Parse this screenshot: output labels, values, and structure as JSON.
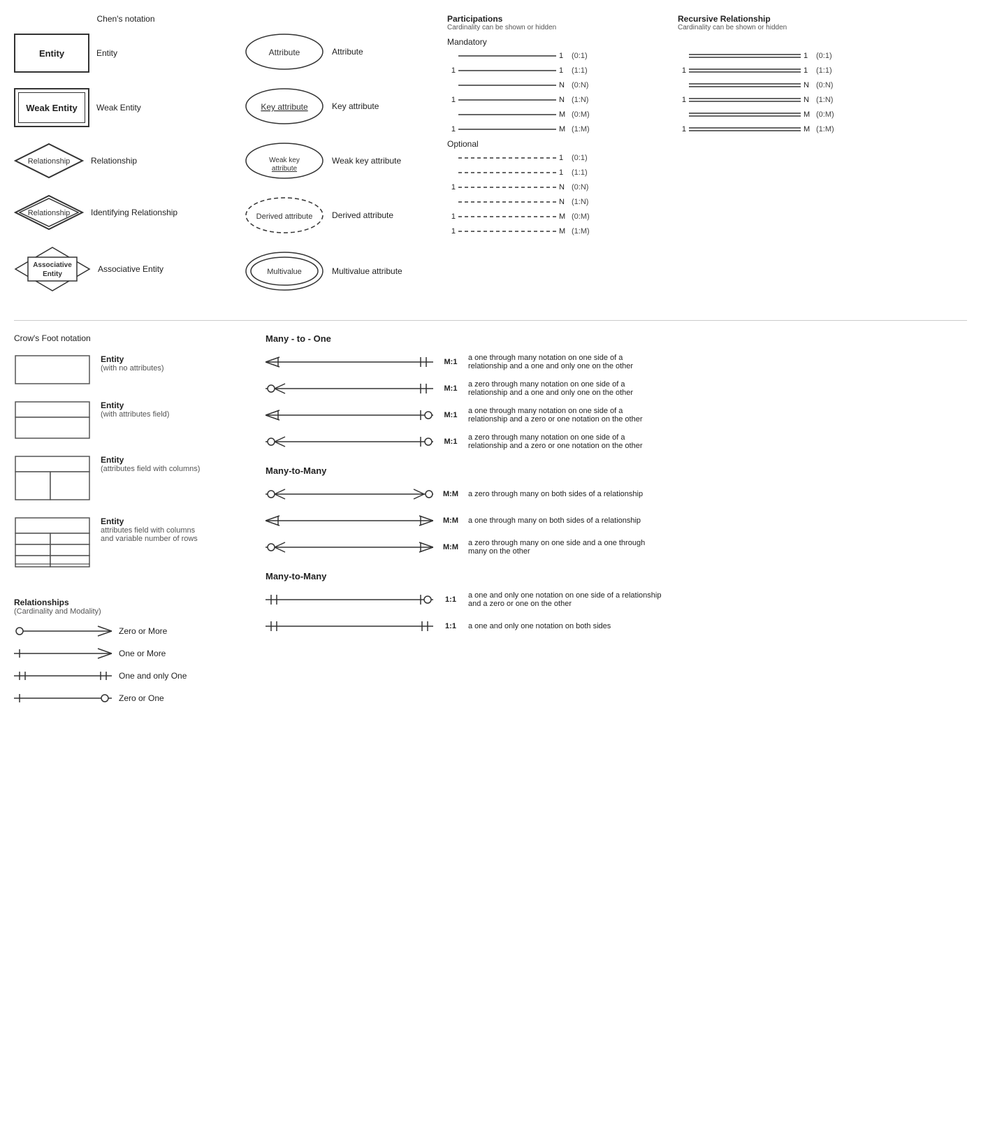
{
  "chens": {
    "title": "Chen's notation",
    "rows": [
      {
        "id": "entity",
        "shape": "entity",
        "label": "Entity",
        "text": "Entity"
      },
      {
        "id": "weak-entity",
        "shape": "weak-entity",
        "label": "Weak Entity",
        "text": "Weak Entity"
      },
      {
        "id": "relationship",
        "shape": "relationship",
        "label": "Relationship",
        "text": "Relationship"
      },
      {
        "id": "id-relationship",
        "shape": "id-relationship",
        "label": "Relationship",
        "text": "Identifying Relationship"
      },
      {
        "id": "assoc-entity",
        "shape": "assoc-entity",
        "label": "Associative\nEntity",
        "text": "Associative Entity"
      }
    ]
  },
  "attributes": {
    "rows": [
      {
        "id": "attribute",
        "shape": "ellipse",
        "label": "Attribute",
        "text": "Attribute"
      },
      {
        "id": "key-attribute",
        "shape": "ellipse-underline",
        "label": "Key attribute",
        "text": "Key attribute"
      },
      {
        "id": "weak-key",
        "shape": "ellipse-dashed-underline",
        "label": "Weak key attribute",
        "text": "Weak key attribute"
      },
      {
        "id": "derived",
        "shape": "ellipse-dashed",
        "label": "Derived attribute",
        "text": "Derived attribute"
      },
      {
        "id": "multivalue",
        "shape": "ellipse-double",
        "label": "Multivalue attribute",
        "text": "Multivalue attribute"
      }
    ]
  },
  "participations": {
    "title": "Participations",
    "subtitle": "Cardinality can be shown or hidden",
    "mandatory": {
      "title": "Mandatory",
      "rows": [
        {
          "left": "",
          "right": "1",
          "notation": "(0:1)"
        },
        {
          "left": "1",
          "right": "1",
          "notation": "(1:1)"
        },
        {
          "left": "",
          "right": "N",
          "notation": "(0:N)"
        },
        {
          "left": "1",
          "right": "N",
          "notation": "(1:N)"
        },
        {
          "left": "",
          "right": "M",
          "notation": "(0:M)"
        },
        {
          "left": "1",
          "right": "M",
          "notation": "(1:M)"
        }
      ]
    },
    "optional": {
      "title": "Optional",
      "rows": [
        {
          "left": "",
          "right": "1",
          "notation": "(0:1)"
        },
        {
          "left": "",
          "right": "1",
          "notation": "(1:1)"
        },
        {
          "left": "1",
          "right": "N",
          "notation": "(0:N)"
        },
        {
          "left": "",
          "right": "N",
          "notation": "(1:N)"
        },
        {
          "left": "1",
          "right": "M",
          "notation": "(0:M)"
        },
        {
          "left": "1",
          "right": "M",
          "notation": "(1:M)"
        }
      ]
    }
  },
  "recursive": {
    "title": "Recursive Relationship",
    "subtitle": "Cardinality can be shown or hidden",
    "rows": [
      {
        "left": "",
        "right": "1",
        "notation": "(0:1)"
      },
      {
        "left": "1",
        "right": "1",
        "notation": "(1:1)"
      },
      {
        "left": "",
        "right": "N",
        "notation": "(0:N)"
      },
      {
        "left": "1",
        "right": "N",
        "notation": "(1:N)"
      },
      {
        "left": "",
        "right": "M",
        "notation": "(0:M)"
      },
      {
        "left": "1",
        "right": "M",
        "notation": "(1:M)"
      }
    ]
  },
  "crows": {
    "title": "Crow's Foot notation",
    "entities": [
      {
        "type": "simple",
        "label": "Entity",
        "sublabel": "(with no attributes)"
      },
      {
        "type": "attrs",
        "label": "Entity",
        "sublabel": "(with attributes field)"
      },
      {
        "type": "columns",
        "label": "Entity",
        "sublabel": "(attributes field with columns)"
      },
      {
        "type": "rows",
        "label": "Entity",
        "sublabel": "(attributes field with columns and\nvariable number of rows)"
      }
    ],
    "relationships_title": "Relationships",
    "relationships_subtitle": "(Cardinality and Modality)",
    "rel_rows": [
      {
        "type": "zero-more",
        "label": "Zero or More"
      },
      {
        "type": "one-more",
        "label": "One or More"
      },
      {
        "type": "one-only",
        "label": "One and only One"
      },
      {
        "type": "zero-one",
        "label": "Zero or One"
      }
    ]
  },
  "many_to_one": {
    "title": "Many - to - One",
    "rows": [
      {
        "left_symbol": "many-mandatory",
        "label": "M:1",
        "right_symbol": "one-only",
        "desc": "a one through many notation on one side of a relationship and a one and only one on the other"
      },
      {
        "left_symbol": "many-optional",
        "label": "M:1",
        "right_symbol": "one-only",
        "desc": "a zero through many notation on one side of a relationship and a one and only one on the other"
      },
      {
        "left_symbol": "many-mandatory",
        "label": "M:1",
        "right_symbol": "zero-one",
        "desc": "a one through many notation on one side of a relationship and a zero or one notation on the other"
      },
      {
        "left_symbol": "many-optional",
        "label": "M:1",
        "right_symbol": "zero-one",
        "desc": "a zero through many notation on one side of a relationship and a zero or one notation on the other"
      }
    ]
  },
  "many_to_many": {
    "title": "Many-to-Many",
    "rows": [
      {
        "left_symbol": "many-optional",
        "label": "M:M",
        "right_symbol": "many-optional-r",
        "desc": "a zero through many on both sides of a relationship"
      },
      {
        "left_symbol": "many-mandatory",
        "label": "M:M",
        "right_symbol": "many-mandatory-r",
        "desc": "a one through many on both sides of a relationship"
      },
      {
        "left_symbol": "many-optional",
        "label": "M:M",
        "right_symbol": "many-mandatory-r",
        "desc": "a zero through many on one side and a one through many on the other"
      }
    ]
  },
  "one_to_one": {
    "title": "Many-to-Many",
    "rows": [
      {
        "left_symbol": "one-only-l",
        "label": "1:1",
        "right_symbol": "zero-one",
        "desc": "a one and only one notation on one side of a relationship and a zero or one on the other"
      },
      {
        "left_symbol": "one-only-l",
        "label": "1:1",
        "right_symbol": "one-only",
        "desc": "a one and only one notation on both sides"
      }
    ]
  }
}
